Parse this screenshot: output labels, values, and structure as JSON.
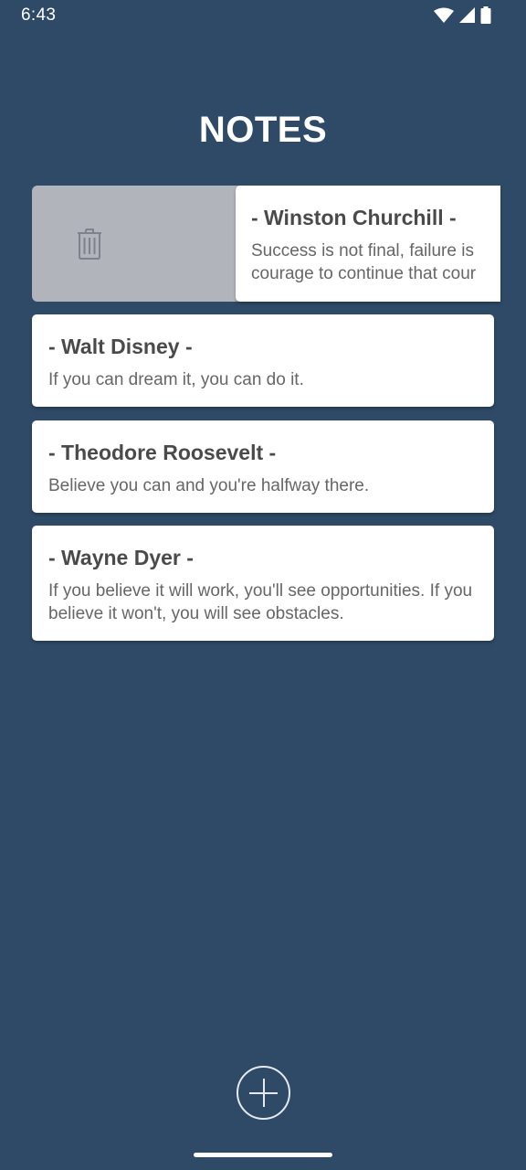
{
  "status_bar": {
    "time": "6:43"
  },
  "header": {
    "title": "NOTES"
  },
  "notes": [
    {
      "title": "- Winston Churchill -",
      "body_line1": "Success is not final, failure is",
      "body_line2": "courage to continue that cour"
    },
    {
      "title": "- Walt Disney -",
      "body": "If you can dream it, you can do it."
    },
    {
      "title": "- Theodore Roosevelt -",
      "body": "Believe you can and you're halfway there."
    },
    {
      "title": "- Wayne Dyer -",
      "body": "If you believe it will work, you'll see opportunities. If you believe it won't, you will see obstacles."
    }
  ],
  "icons": {
    "delete": "trash-icon",
    "add": "plus-circle-icon",
    "wifi": "wifi-icon",
    "signal": "signal-icon",
    "battery": "battery-icon"
  },
  "colors": {
    "background": "#2e4a66",
    "card": "#ffffff",
    "delete_background": "#b1b4ba",
    "title_text": "#4a4a4a",
    "body_text": "#666666"
  }
}
